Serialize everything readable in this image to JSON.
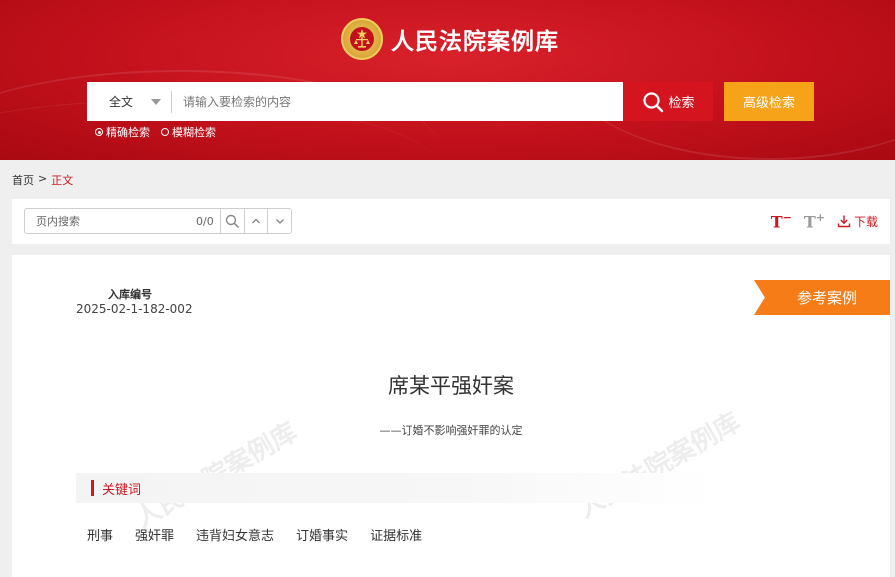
{
  "header": {
    "site_title": "人民法院案例库",
    "emblem_icon": "court-emblem-icon"
  },
  "search": {
    "scope_selected": "全文",
    "placeholder": "请输入要检索的内容",
    "search_label": "检索",
    "advanced_label": "高级检索",
    "modes": [
      {
        "label": "精确检索",
        "selected": true
      },
      {
        "label": "模糊检索",
        "selected": false
      }
    ]
  },
  "breadcrumb": {
    "home": "首页",
    "separator": ">",
    "current": "正文"
  },
  "toolbar": {
    "find_placeholder": "页内搜索",
    "find_count": "0/0",
    "font_decrease_label": "T",
    "font_decrease_sign": "−",
    "font_increase_label": "T",
    "font_increase_sign": "+",
    "download_label": "下载"
  },
  "case": {
    "code_label": "入库编号",
    "code_value": "2025-02-1-182-002",
    "ribbon_label": "参考案例",
    "title": "席某平强奸案",
    "subtitle": "——订婚不影响强奸罪的认定",
    "watermark": "人民法院案例库",
    "keywords_title": "关键词",
    "keywords": [
      "刑事",
      "强奸罪",
      "违背妇女意志",
      "订婚事实",
      "证据标准"
    ]
  },
  "colors": {
    "brand_red": "#d4141f",
    "accent_orange": "#f7a31a",
    "ribbon_orange": "#f57c16",
    "link_red": "#c81a20"
  }
}
